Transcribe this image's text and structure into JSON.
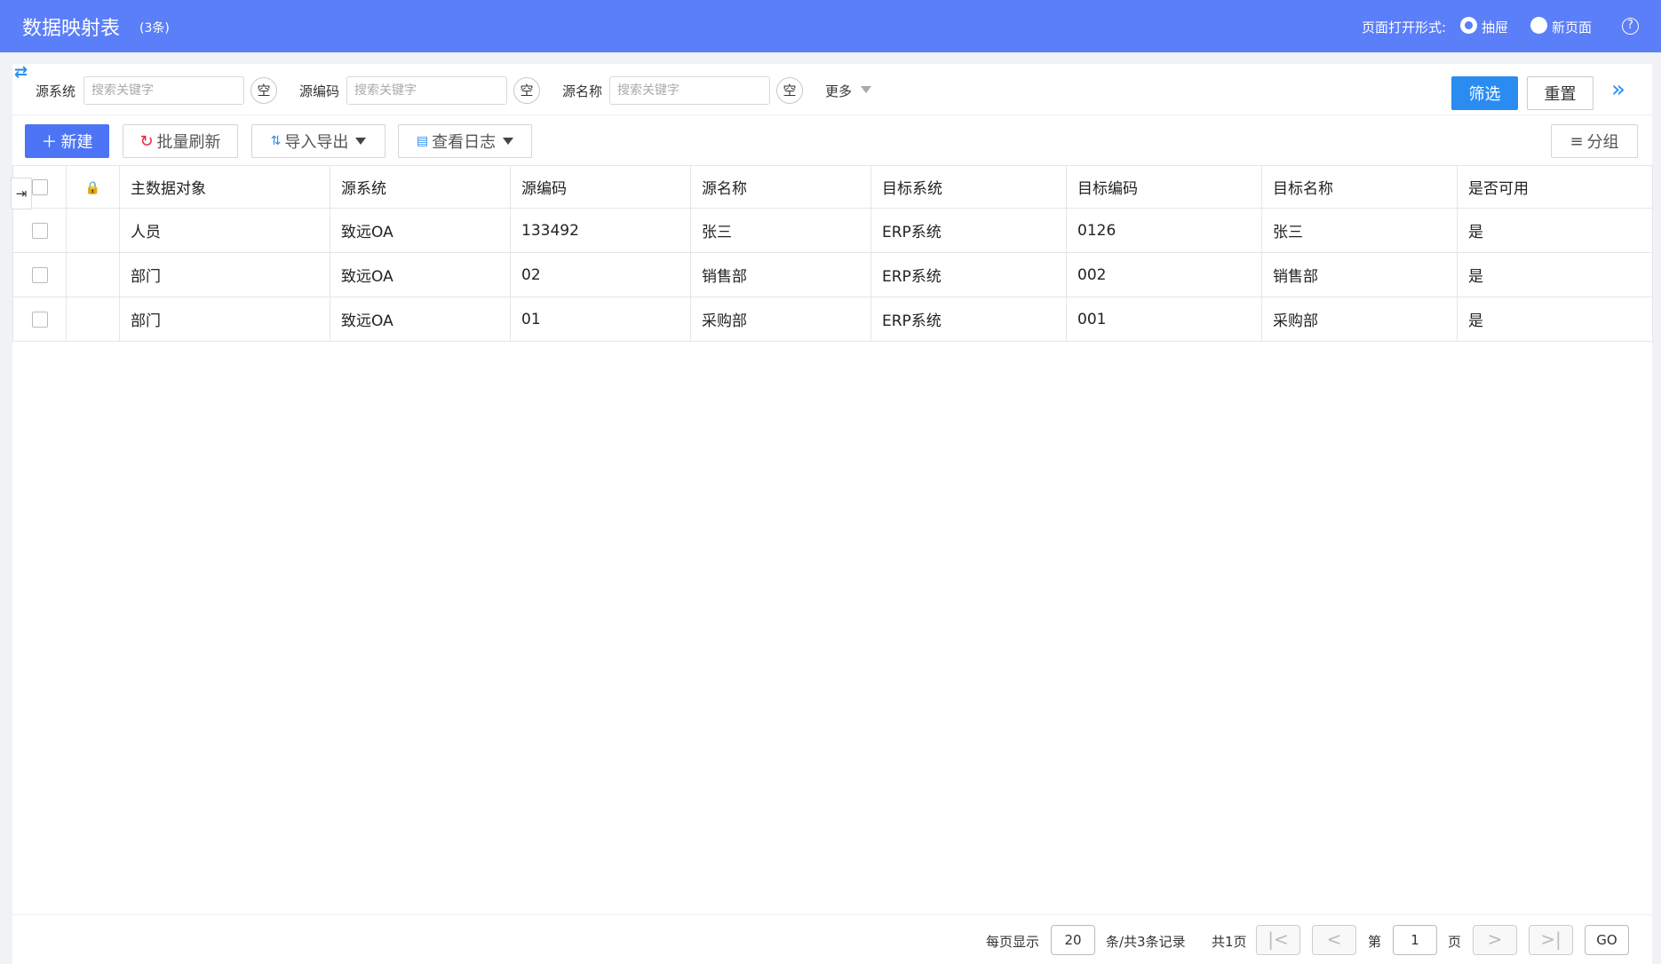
{
  "header": {
    "title": "数据映射表",
    "count": "(3条)",
    "open_mode_label": "页面打开形式:",
    "modes": [
      "抽屉",
      "新页面"
    ],
    "selected_mode": "抽屉",
    "help": "?"
  },
  "filters": [
    {
      "label": "源系统",
      "placeholder": "搜索关键字",
      "clear": "空"
    },
    {
      "label": "源编码",
      "placeholder": "搜索关键字",
      "clear": "空"
    },
    {
      "label": "源名称",
      "placeholder": "搜索关键字",
      "clear": "空"
    }
  ],
  "more_label": "更多",
  "filter_button": "筛选",
  "reset_button": "重置",
  "toolbar": {
    "new": "新建",
    "batch_refresh": "批量刷新",
    "import_export": "导入导出",
    "view_log": "查看日志",
    "group": "分组"
  },
  "table": {
    "columns": [
      "主数据对象",
      "源系统",
      "源编码",
      "源名称",
      "目标系统",
      "目标编码",
      "目标名称",
      "是否可用"
    ],
    "rows": [
      [
        "人员",
        "致远OA",
        "133492",
        "张三",
        "ERP系统",
        "0126",
        "张三",
        "是"
      ],
      [
        "部门",
        "致远OA",
        "02",
        "销售部",
        "ERP系统",
        "002",
        "销售部",
        "是"
      ],
      [
        "部门",
        "致远OA",
        "01",
        "采购部",
        "ERP系统",
        "001",
        "采购部",
        "是"
      ]
    ]
  },
  "pagination": {
    "per_page_label": "每页显示",
    "per_page": "20",
    "total_label": "条/共3条记录",
    "pages_label": "共1页",
    "page_prefix": "第",
    "page": "1",
    "page_suffix": "页",
    "go": "GO"
  }
}
